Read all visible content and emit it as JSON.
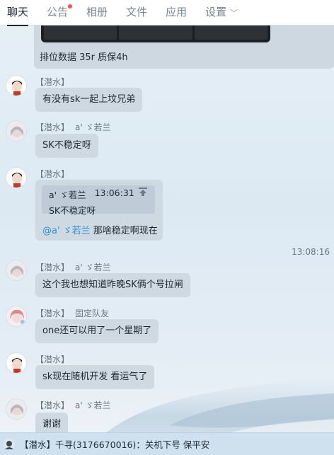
{
  "tabs": [
    {
      "label": "聊天",
      "active": true
    },
    {
      "label": "公告",
      "badge_dot": true
    },
    {
      "label": "相册"
    },
    {
      "label": "文件"
    },
    {
      "label": "应用"
    },
    {
      "label": "设置",
      "chevron": "chevron-down-icon"
    }
  ],
  "chevron_glyph": "﹀",
  "first_message": {
    "text": "排位数据 35r  质保4h"
  },
  "messages": [
    {
      "tag": "【潜水】",
      "name": "",
      "text": "有没有sk一起上坟兄弟"
    },
    {
      "tag": "【潜水】",
      "name": "a' ゞ若兰",
      "text": "SK不稳定呀"
    },
    {
      "tag": "【潜水】",
      "name": "",
      "quote": {
        "author": "a' ゞ若兰",
        "time": "13:06:31",
        "text": "SK不稳定呀",
        "icon": "jump-to-icon"
      },
      "mention": "@a' ゞ若兰",
      "text": "那啥稳定啊现在"
    },
    {
      "time_separator": "13:08:16"
    },
    {
      "tag": "【潜水】",
      "name": "a' ゞ若兰",
      "text": "这个我也想知道昨晚SK俩个号拉闸"
    },
    {
      "tag": "【潜水】",
      "name": "固定队友",
      "text": "one还可以用了一个星期了"
    },
    {
      "tag": "【潜水】",
      "name": "",
      "text": "sk现在随机开发  看运气了"
    },
    {
      "tag": "【潜水】",
      "name": "a' ゞ若兰",
      "text": "谢谢"
    }
  ],
  "notice": {
    "tag": "【潜水】",
    "sender": "千寻(3176670016)",
    "separator": "：",
    "text": "关机下号 保平安"
  },
  "colors": {
    "accent": "#2f8fd9",
    "badge": "#ef5350",
    "bubble": "#cfd9e2"
  }
}
